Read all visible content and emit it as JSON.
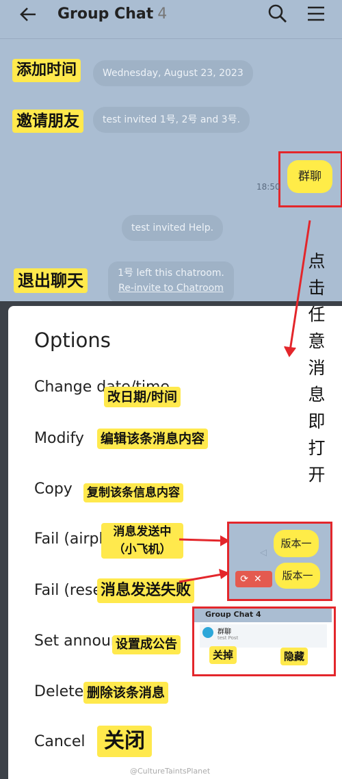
{
  "header": {
    "title": "Group Chat",
    "member_count": "4"
  },
  "chat": {
    "date_msg": "Wednesday, August 23, 2023",
    "invite_msg": "test invited 1号, 2号 and 3号.",
    "time": "18:50",
    "bubble_text": "群聊",
    "invite_help_msg": "test invited Help.",
    "left_msg": "1号 left this chatroom.",
    "reinvite_link": "Re-invite to Chatroom"
  },
  "annotations": {
    "add_time": "添加时间",
    "invite_friends": "邀请朋友",
    "exit_chat": "退出聊天",
    "vertical_note": [
      "点",
      "击",
      "任",
      "意",
      "消",
      "息",
      "即",
      "打",
      "开"
    ]
  },
  "options": {
    "title": "Options",
    "items": [
      {
        "label": "Change date/time",
        "note": "改日期/时间"
      },
      {
        "label": "Modify",
        "note": "编辑该条消息内容"
      },
      {
        "label": "Copy",
        "note": "复制该条信息内容"
      },
      {
        "label": "Fail (airplane)",
        "note": "消息发送中\n（小飞机）"
      },
      {
        "label": "Fail (resend)",
        "note": "消息发送失败"
      },
      {
        "label": "Set announcement",
        "note": "设置成公告"
      },
      {
        "label": "Delete",
        "note": "删除该条消息"
      },
      {
        "label": "Cancel",
        "note": "关闭"
      }
    ]
  },
  "inset_fail": {
    "bubble1": "版本一",
    "bubble2": "版本一"
  },
  "inset_announce": {
    "title": "Group Chat 4",
    "name": "群聊",
    "sub": "test Post",
    "left_note": "关掉",
    "right_note": "隐藏"
  },
  "watermark": "@CultureTaintsPlanet",
  "colors": {
    "accent_red": "#e3262b",
    "bubble_yellow": "#ffec48",
    "chat_bg": "#aabdd2"
  }
}
